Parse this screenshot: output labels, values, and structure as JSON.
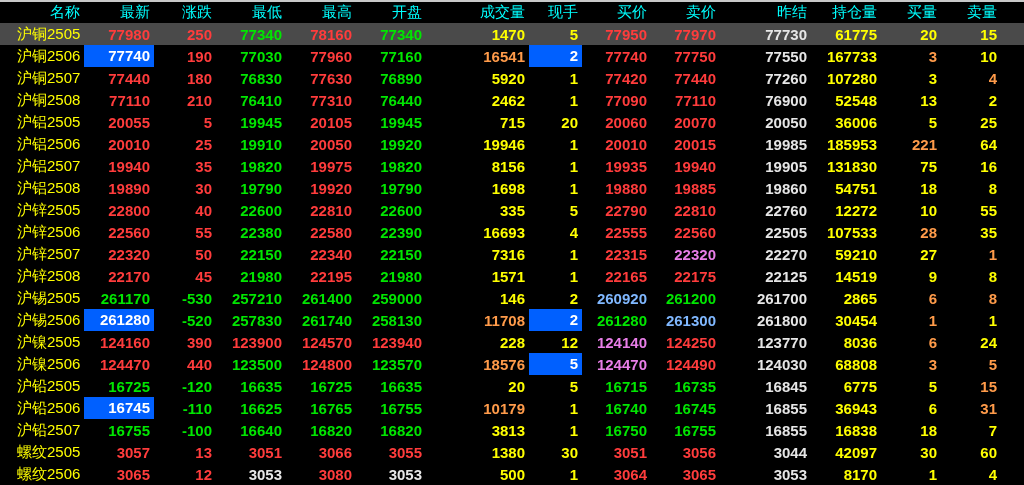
{
  "columns": [
    "名称",
    "最新",
    "涨跌",
    "最低",
    "最高",
    "开盘",
    "成交量",
    "现手",
    "买价",
    "卖价",
    "昨结",
    "持仓量",
    "买量",
    "卖量"
  ],
  "rows": [
    {
      "name": "沪铜2505",
      "selected": true,
      "cells": [
        {
          "text": "77980",
          "color": "#ff3c3c",
          "highlighted": false
        },
        {
          "text": "250",
          "color": "#ff3c3c"
        },
        {
          "text": "77340",
          "color": "#00e600"
        },
        {
          "text": "78160",
          "color": "#ff3c3c"
        },
        {
          "text": "77340",
          "color": "#00e600"
        },
        {
          "text": "1470",
          "color": "#ffff00"
        },
        {
          "text": "5",
          "color": "#ffff00",
          "highlighted": false
        },
        {
          "text": "77950",
          "color": "#ff3c3c"
        },
        {
          "text": "77970",
          "color": "#ff3c3c"
        },
        {
          "text": "77730",
          "color": "#e6e6e6"
        },
        {
          "text": "61775",
          "color": "#ffff00"
        },
        {
          "text": "20",
          "color": "#ffff00"
        },
        {
          "text": "15",
          "color": "#ffff00"
        }
      ]
    },
    {
      "name": "沪铜2506",
      "selected": false,
      "cells": [
        {
          "text": "77740",
          "highlighted": true
        },
        {
          "text": "190",
          "color": "#ff3c3c"
        },
        {
          "text": "77030",
          "color": "#00e600"
        },
        {
          "text": "77960",
          "color": "#ff3c3c"
        },
        {
          "text": "77160",
          "color": "#00e600"
        },
        {
          "text": "16541",
          "color": "#ff9b4a"
        },
        {
          "text": "2",
          "highlighted": true
        },
        {
          "text": "77740",
          "color": "#ff3c3c"
        },
        {
          "text": "77750",
          "color": "#ff3c3c"
        },
        {
          "text": "77550",
          "color": "#e6e6e6"
        },
        {
          "text": "167733",
          "color": "#ffff00"
        },
        {
          "text": "3",
          "color": "#ff9b4a"
        },
        {
          "text": "10",
          "color": "#ffff00"
        }
      ]
    },
    {
      "name": "沪铜2507",
      "selected": false,
      "cells": [
        {
          "text": "77440",
          "color": "#ff3c3c",
          "highlighted": false
        },
        {
          "text": "180",
          "color": "#ff3c3c"
        },
        {
          "text": "76830",
          "color": "#00e600"
        },
        {
          "text": "77630",
          "color": "#ff3c3c"
        },
        {
          "text": "76890",
          "color": "#00e600"
        },
        {
          "text": "5920",
          "color": "#ffff00"
        },
        {
          "text": "1",
          "color": "#ffff00",
          "highlighted": false
        },
        {
          "text": "77420",
          "color": "#ff3c3c"
        },
        {
          "text": "77440",
          "color": "#ff3c3c"
        },
        {
          "text": "77260",
          "color": "#e6e6e6"
        },
        {
          "text": "107280",
          "color": "#ffff00"
        },
        {
          "text": "3",
          "color": "#ffff00"
        },
        {
          "text": "4",
          "color": "#ff9b4a"
        }
      ]
    },
    {
      "name": "沪铜2508",
      "selected": false,
      "cells": [
        {
          "text": "77110",
          "color": "#ff3c3c",
          "highlighted": false
        },
        {
          "text": "210",
          "color": "#ff3c3c"
        },
        {
          "text": "76410",
          "color": "#00e600"
        },
        {
          "text": "77310",
          "color": "#ff3c3c"
        },
        {
          "text": "76440",
          "color": "#00e600"
        },
        {
          "text": "2462",
          "color": "#ffff00"
        },
        {
          "text": "1",
          "color": "#ffff00",
          "highlighted": false
        },
        {
          "text": "77090",
          "color": "#ff3c3c"
        },
        {
          "text": "77110",
          "color": "#ff3c3c"
        },
        {
          "text": "76900",
          "color": "#e6e6e6"
        },
        {
          "text": "52548",
          "color": "#ffff00"
        },
        {
          "text": "13",
          "color": "#ffff00"
        },
        {
          "text": "2",
          "color": "#ffff00"
        }
      ]
    },
    {
      "name": "沪铝2505",
      "selected": false,
      "cells": [
        {
          "text": "20055",
          "color": "#ff3c3c",
          "highlighted": false
        },
        {
          "text": "5",
          "color": "#ff3c3c"
        },
        {
          "text": "19945",
          "color": "#00e600"
        },
        {
          "text": "20105",
          "color": "#ff3c3c"
        },
        {
          "text": "19945",
          "color": "#00e600"
        },
        {
          "text": "715",
          "color": "#ffff00"
        },
        {
          "text": "20",
          "color": "#ffff00",
          "highlighted": false
        },
        {
          "text": "20060",
          "color": "#ff3c3c"
        },
        {
          "text": "20070",
          "color": "#ff3c3c"
        },
        {
          "text": "20050",
          "color": "#e6e6e6"
        },
        {
          "text": "36006",
          "color": "#ffff00"
        },
        {
          "text": "5",
          "color": "#ffff00"
        },
        {
          "text": "25",
          "color": "#ffff00"
        }
      ]
    },
    {
      "name": "沪铝2506",
      "selected": false,
      "cells": [
        {
          "text": "20010",
          "color": "#ff3c3c",
          "highlighted": false
        },
        {
          "text": "25",
          "color": "#ff3c3c"
        },
        {
          "text": "19910",
          "color": "#00e600"
        },
        {
          "text": "20050",
          "color": "#ff3c3c"
        },
        {
          "text": "19920",
          "color": "#00e600"
        },
        {
          "text": "19946",
          "color": "#ffff00"
        },
        {
          "text": "1",
          "color": "#ffff00",
          "highlighted": false
        },
        {
          "text": "20010",
          "color": "#ff3c3c"
        },
        {
          "text": "20015",
          "color": "#ff3c3c"
        },
        {
          "text": "19985",
          "color": "#e6e6e6"
        },
        {
          "text": "185953",
          "color": "#ffff00"
        },
        {
          "text": "221",
          "color": "#ff9b4a"
        },
        {
          "text": "64",
          "color": "#ffff00"
        }
      ]
    },
    {
      "name": "沪铝2507",
      "selected": false,
      "cells": [
        {
          "text": "19940",
          "color": "#ff3c3c",
          "highlighted": false
        },
        {
          "text": "35",
          "color": "#ff3c3c"
        },
        {
          "text": "19820",
          "color": "#00e600"
        },
        {
          "text": "19975",
          "color": "#ff3c3c"
        },
        {
          "text": "19820",
          "color": "#00e600"
        },
        {
          "text": "8156",
          "color": "#ffff00"
        },
        {
          "text": "1",
          "color": "#ffff00",
          "highlighted": false
        },
        {
          "text": "19935",
          "color": "#ff3c3c"
        },
        {
          "text": "19940",
          "color": "#ff3c3c"
        },
        {
          "text": "19905",
          "color": "#e6e6e6"
        },
        {
          "text": "131830",
          "color": "#ffff00"
        },
        {
          "text": "75",
          "color": "#ffff00"
        },
        {
          "text": "16",
          "color": "#ffff00"
        }
      ]
    },
    {
      "name": "沪铝2508",
      "selected": false,
      "cells": [
        {
          "text": "19890",
          "color": "#ff3c3c",
          "highlighted": false
        },
        {
          "text": "30",
          "color": "#ff3c3c"
        },
        {
          "text": "19790",
          "color": "#00e600"
        },
        {
          "text": "19920",
          "color": "#ff3c3c"
        },
        {
          "text": "19790",
          "color": "#00e600"
        },
        {
          "text": "1698",
          "color": "#ffff00"
        },
        {
          "text": "1",
          "color": "#ffff00",
          "highlighted": false
        },
        {
          "text": "19880",
          "color": "#ff3c3c"
        },
        {
          "text": "19885",
          "color": "#ff3c3c"
        },
        {
          "text": "19860",
          "color": "#e6e6e6"
        },
        {
          "text": "54751",
          "color": "#ffff00"
        },
        {
          "text": "18",
          "color": "#ffff00"
        },
        {
          "text": "8",
          "color": "#ffff00"
        }
      ]
    },
    {
      "name": "沪锌2505",
      "selected": false,
      "cells": [
        {
          "text": "22800",
          "color": "#ff3c3c",
          "highlighted": false
        },
        {
          "text": "40",
          "color": "#ff3c3c"
        },
        {
          "text": "22600",
          "color": "#00e600"
        },
        {
          "text": "22810",
          "color": "#ff3c3c"
        },
        {
          "text": "22600",
          "color": "#00e600"
        },
        {
          "text": "335",
          "color": "#ffff00"
        },
        {
          "text": "5",
          "color": "#ffff00",
          "highlighted": false
        },
        {
          "text": "22790",
          "color": "#ff3c3c"
        },
        {
          "text": "22810",
          "color": "#ff3c3c"
        },
        {
          "text": "22760",
          "color": "#e6e6e6"
        },
        {
          "text": "12272",
          "color": "#ffff00"
        },
        {
          "text": "10",
          "color": "#ffff00"
        },
        {
          "text": "55",
          "color": "#ffff00"
        }
      ]
    },
    {
      "name": "沪锌2506",
      "selected": false,
      "cells": [
        {
          "text": "22560",
          "color": "#ff3c3c",
          "highlighted": false
        },
        {
          "text": "55",
          "color": "#ff3c3c"
        },
        {
          "text": "22380",
          "color": "#00e600"
        },
        {
          "text": "22580",
          "color": "#ff3c3c"
        },
        {
          "text": "22390",
          "color": "#00e600"
        },
        {
          "text": "16693",
          "color": "#ffff00"
        },
        {
          "text": "4",
          "color": "#ffff00",
          "highlighted": false
        },
        {
          "text": "22555",
          "color": "#ff3c3c"
        },
        {
          "text": "22560",
          "color": "#ff3c3c"
        },
        {
          "text": "22505",
          "color": "#e6e6e6"
        },
        {
          "text": "107533",
          "color": "#ffff00"
        },
        {
          "text": "28",
          "color": "#ff9b4a"
        },
        {
          "text": "35",
          "color": "#ffff00"
        }
      ]
    },
    {
      "name": "沪锌2507",
      "selected": false,
      "cells": [
        {
          "text": "22320",
          "color": "#ff3c3c",
          "highlighted": false
        },
        {
          "text": "50",
          "color": "#ff3c3c"
        },
        {
          "text": "22150",
          "color": "#00e600"
        },
        {
          "text": "22340",
          "color": "#ff3c3c"
        },
        {
          "text": "22150",
          "color": "#00e600"
        },
        {
          "text": "7316",
          "color": "#ffff00"
        },
        {
          "text": "1",
          "color": "#ffff00",
          "highlighted": false
        },
        {
          "text": "22315",
          "color": "#ff3c3c"
        },
        {
          "text": "22320",
          "color": "#e87ee8"
        },
        {
          "text": "22270",
          "color": "#e6e6e6"
        },
        {
          "text": "59210",
          "color": "#ffff00"
        },
        {
          "text": "27",
          "color": "#ffff00"
        },
        {
          "text": "1",
          "color": "#ff9b4a"
        }
      ]
    },
    {
      "name": "沪锌2508",
      "selected": false,
      "cells": [
        {
          "text": "22170",
          "color": "#ff3c3c",
          "highlighted": false
        },
        {
          "text": "45",
          "color": "#ff3c3c"
        },
        {
          "text": "21980",
          "color": "#00e600"
        },
        {
          "text": "22195",
          "color": "#ff3c3c"
        },
        {
          "text": "21980",
          "color": "#00e600"
        },
        {
          "text": "1571",
          "color": "#ffff00"
        },
        {
          "text": "1",
          "color": "#ffff00",
          "highlighted": false
        },
        {
          "text": "22165",
          "color": "#ff3c3c"
        },
        {
          "text": "22175",
          "color": "#ff3c3c"
        },
        {
          "text": "22125",
          "color": "#e6e6e6"
        },
        {
          "text": "14519",
          "color": "#ffff00"
        },
        {
          "text": "9",
          "color": "#ffff00"
        },
        {
          "text": "8",
          "color": "#ffff00"
        }
      ]
    },
    {
      "name": "沪锡2505",
      "selected": false,
      "cells": [
        {
          "text": "261170",
          "color": "#00e600",
          "highlighted": false
        },
        {
          "text": "-530",
          "color": "#00e600"
        },
        {
          "text": "257210",
          "color": "#00e600"
        },
        {
          "text": "261400",
          "color": "#00e600"
        },
        {
          "text": "259000",
          "color": "#00e600"
        },
        {
          "text": "146",
          "color": "#ffff00"
        },
        {
          "text": "2",
          "color": "#ffff00",
          "highlighted": false
        },
        {
          "text": "260920",
          "color": "#80b8ff"
        },
        {
          "text": "261200",
          "color": "#00e600"
        },
        {
          "text": "261700",
          "color": "#e6e6e6"
        },
        {
          "text": "2865",
          "color": "#ffff00"
        },
        {
          "text": "6",
          "color": "#ff9b4a"
        },
        {
          "text": "8",
          "color": "#ff9b4a"
        }
      ]
    },
    {
      "name": "沪锡2506",
      "selected": false,
      "cells": [
        {
          "text": "261280",
          "highlighted": true
        },
        {
          "text": "-520",
          "color": "#00e600"
        },
        {
          "text": "257830",
          "color": "#00e600"
        },
        {
          "text": "261740",
          "color": "#00e600"
        },
        {
          "text": "258130",
          "color": "#00e600"
        },
        {
          "text": "11708",
          "color": "#ff9b4a"
        },
        {
          "text": "2",
          "highlighted": true
        },
        {
          "text": "261280",
          "color": "#00e600"
        },
        {
          "text": "261300",
          "color": "#80b8ff"
        },
        {
          "text": "261800",
          "color": "#e6e6e6"
        },
        {
          "text": "30454",
          "color": "#ffff00"
        },
        {
          "text": "1",
          "color": "#ff9b4a"
        },
        {
          "text": "1",
          "color": "#ffff00"
        }
      ]
    },
    {
      "name": "沪镍2505",
      "selected": false,
      "cells": [
        {
          "text": "124160",
          "color": "#ff3c3c",
          "highlighted": false
        },
        {
          "text": "390",
          "color": "#ff3c3c"
        },
        {
          "text": "123900",
          "color": "#ff3c3c"
        },
        {
          "text": "124570",
          "color": "#ff3c3c"
        },
        {
          "text": "123940",
          "color": "#ff3c3c"
        },
        {
          "text": "228",
          "color": "#ffff00"
        },
        {
          "text": "12",
          "color": "#ffff00",
          "highlighted": false
        },
        {
          "text": "124140",
          "color": "#e87ee8"
        },
        {
          "text": "124250",
          "color": "#ff3c3c"
        },
        {
          "text": "123770",
          "color": "#e6e6e6"
        },
        {
          "text": "8036",
          "color": "#ffff00"
        },
        {
          "text": "6",
          "color": "#ff9b4a"
        },
        {
          "text": "24",
          "color": "#ffff00"
        }
      ]
    },
    {
      "name": "沪镍2506",
      "selected": false,
      "cells": [
        {
          "text": "124470",
          "color": "#ff3c3c",
          "highlighted": false
        },
        {
          "text": "440",
          "color": "#ff3c3c"
        },
        {
          "text": "123500",
          "color": "#00e600"
        },
        {
          "text": "124800",
          "color": "#ff3c3c"
        },
        {
          "text": "123570",
          "color": "#00e600"
        },
        {
          "text": "18576",
          "color": "#ff9b4a"
        },
        {
          "text": "5",
          "highlighted": true
        },
        {
          "text": "124470",
          "color": "#e87ee8"
        },
        {
          "text": "124490",
          "color": "#ff3c3c"
        },
        {
          "text": "124030",
          "color": "#e6e6e6"
        },
        {
          "text": "68808",
          "color": "#ffff00"
        },
        {
          "text": "3",
          "color": "#ff9b4a"
        },
        {
          "text": "5",
          "color": "#ff9b4a"
        }
      ]
    },
    {
      "name": "沪铅2505",
      "selected": false,
      "cells": [
        {
          "text": "16725",
          "color": "#00e600",
          "highlighted": false
        },
        {
          "text": "-120",
          "color": "#00e600"
        },
        {
          "text": "16635",
          "color": "#00e600"
        },
        {
          "text": "16725",
          "color": "#00e600"
        },
        {
          "text": "16635",
          "color": "#00e600"
        },
        {
          "text": "20",
          "color": "#ffff00"
        },
        {
          "text": "5",
          "color": "#ffff00",
          "highlighted": false
        },
        {
          "text": "16715",
          "color": "#00e600"
        },
        {
          "text": "16735",
          "color": "#00e600"
        },
        {
          "text": "16845",
          "color": "#e6e6e6"
        },
        {
          "text": "6775",
          "color": "#ffff00"
        },
        {
          "text": "5",
          "color": "#ffff00"
        },
        {
          "text": "15",
          "color": "#ff9b4a"
        }
      ]
    },
    {
      "name": "沪铅2506",
      "selected": false,
      "cells": [
        {
          "text": "16745",
          "highlighted": true
        },
        {
          "text": "-110",
          "color": "#00e600"
        },
        {
          "text": "16625",
          "color": "#00e600"
        },
        {
          "text": "16765",
          "color": "#00e600"
        },
        {
          "text": "16755",
          "color": "#00e600"
        },
        {
          "text": "10179",
          "color": "#ff9b4a"
        },
        {
          "text": "1",
          "color": "#ffff00",
          "highlighted": false
        },
        {
          "text": "16740",
          "color": "#00e600"
        },
        {
          "text": "16745",
          "color": "#00e600"
        },
        {
          "text": "16855",
          "color": "#e6e6e6"
        },
        {
          "text": "36943",
          "color": "#ffff00"
        },
        {
          "text": "6",
          "color": "#ffff00"
        },
        {
          "text": "31",
          "color": "#ff9b4a"
        }
      ]
    },
    {
      "name": "沪铅2507",
      "selected": false,
      "cells": [
        {
          "text": "16755",
          "color": "#00e600",
          "highlighted": false
        },
        {
          "text": "-100",
          "color": "#00e600"
        },
        {
          "text": "16640",
          "color": "#00e600"
        },
        {
          "text": "16820",
          "color": "#00e600"
        },
        {
          "text": "16820",
          "color": "#00e600"
        },
        {
          "text": "3813",
          "color": "#ffff00"
        },
        {
          "text": "1",
          "color": "#ffff00",
          "highlighted": false
        },
        {
          "text": "16750",
          "color": "#00e600"
        },
        {
          "text": "16755",
          "color": "#00e600"
        },
        {
          "text": "16855",
          "color": "#e6e6e6"
        },
        {
          "text": "16838",
          "color": "#ffff00"
        },
        {
          "text": "18",
          "color": "#ffff00"
        },
        {
          "text": "7",
          "color": "#ffff00"
        }
      ]
    },
    {
      "name": "螺纹2505",
      "selected": false,
      "cells": [
        {
          "text": "3057",
          "color": "#ff3c3c",
          "highlighted": false
        },
        {
          "text": "13",
          "color": "#ff3c3c"
        },
        {
          "text": "3051",
          "color": "#ff3c3c"
        },
        {
          "text": "3066",
          "color": "#ff3c3c"
        },
        {
          "text": "3055",
          "color": "#ff3c3c"
        },
        {
          "text": "1380",
          "color": "#ffff00"
        },
        {
          "text": "30",
          "color": "#ffff00",
          "highlighted": false
        },
        {
          "text": "3051",
          "color": "#ff3c3c"
        },
        {
          "text": "3056",
          "color": "#ff3c3c"
        },
        {
          "text": "3044",
          "color": "#e6e6e6"
        },
        {
          "text": "42097",
          "color": "#ffff00"
        },
        {
          "text": "30",
          "color": "#ffff00"
        },
        {
          "text": "60",
          "color": "#ffff00"
        }
      ]
    },
    {
      "name": "螺纹2506",
      "selected": false,
      "cells": [
        {
          "text": "3065",
          "color": "#ff3c3c",
          "highlighted": false
        },
        {
          "text": "12",
          "color": "#ff3c3c"
        },
        {
          "text": "3053",
          "color": "#e6e6e6"
        },
        {
          "text": "3080",
          "color": "#ff3c3c"
        },
        {
          "text": "3053",
          "color": "#e6e6e6"
        },
        {
          "text": "500",
          "color": "#ffff00"
        },
        {
          "text": "1",
          "color": "#ffff00",
          "highlighted": false
        },
        {
          "text": "3064",
          "color": "#ff3c3c"
        },
        {
          "text": "3065",
          "color": "#ff3c3c"
        },
        {
          "text": "3053",
          "color": "#e6e6e6"
        },
        {
          "text": "8170",
          "color": "#ffff00"
        },
        {
          "text": "1",
          "color": "#ffff00"
        },
        {
          "text": "4",
          "color": "#ffff00"
        }
      ]
    }
  ]
}
